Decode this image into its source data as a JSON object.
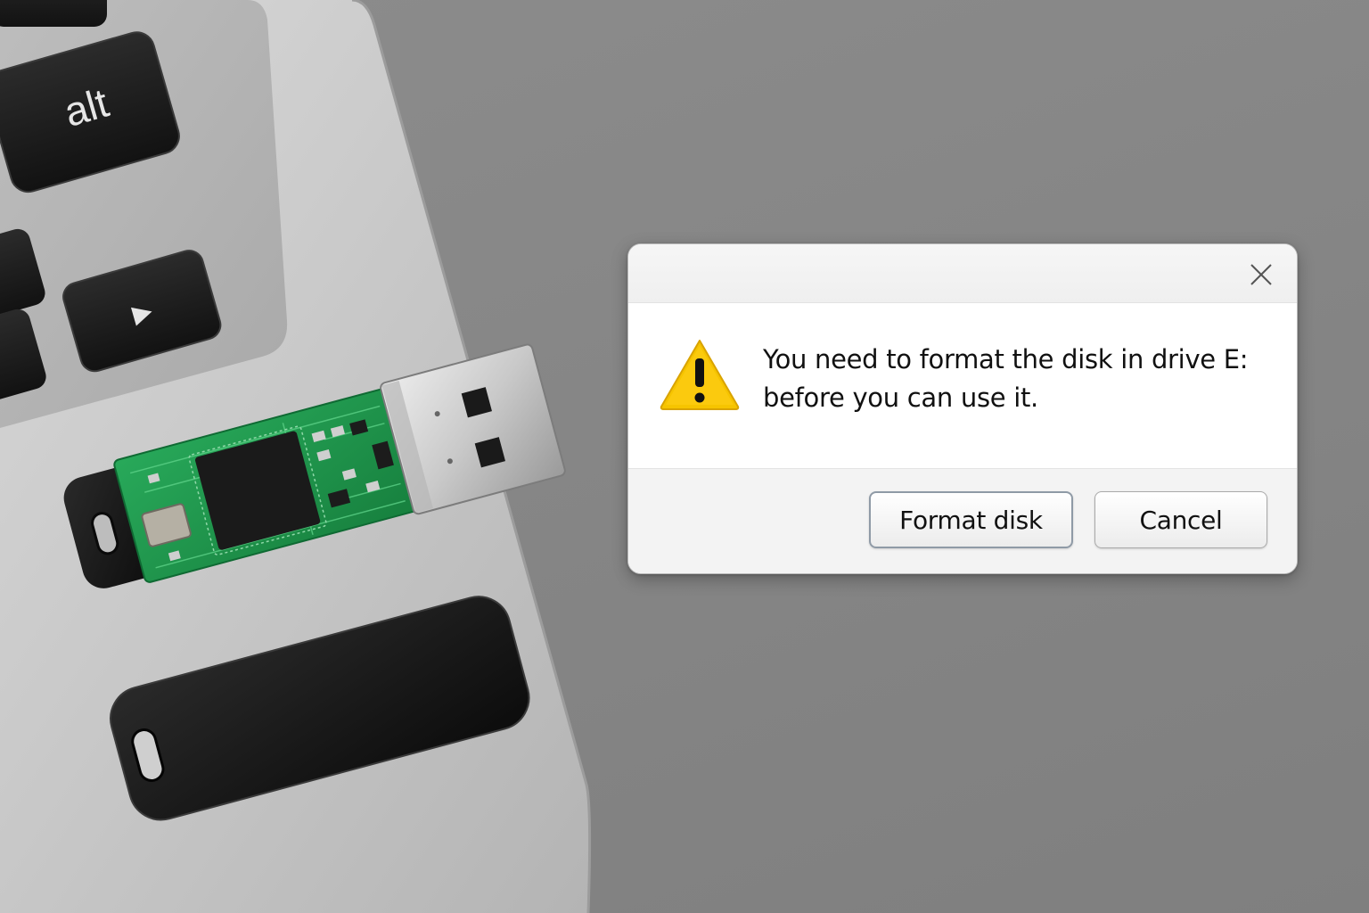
{
  "background": {
    "keyboard_keys": [
      "alt",
      "▶"
    ]
  },
  "dialog": {
    "close_icon": "close-icon",
    "warning_icon": "warning-triangle-icon",
    "message_line1": "You need to format the disk in drive E:",
    "message_line2": "before you can use it.",
    "format_button": "Format disk",
    "cancel_button": "Cancel"
  },
  "colors": {
    "warning_yellow": "#f6c400",
    "dialog_bg": "#ffffff",
    "footer_bg": "#f3f3f3",
    "pcb_green": "#1f9a4c"
  }
}
